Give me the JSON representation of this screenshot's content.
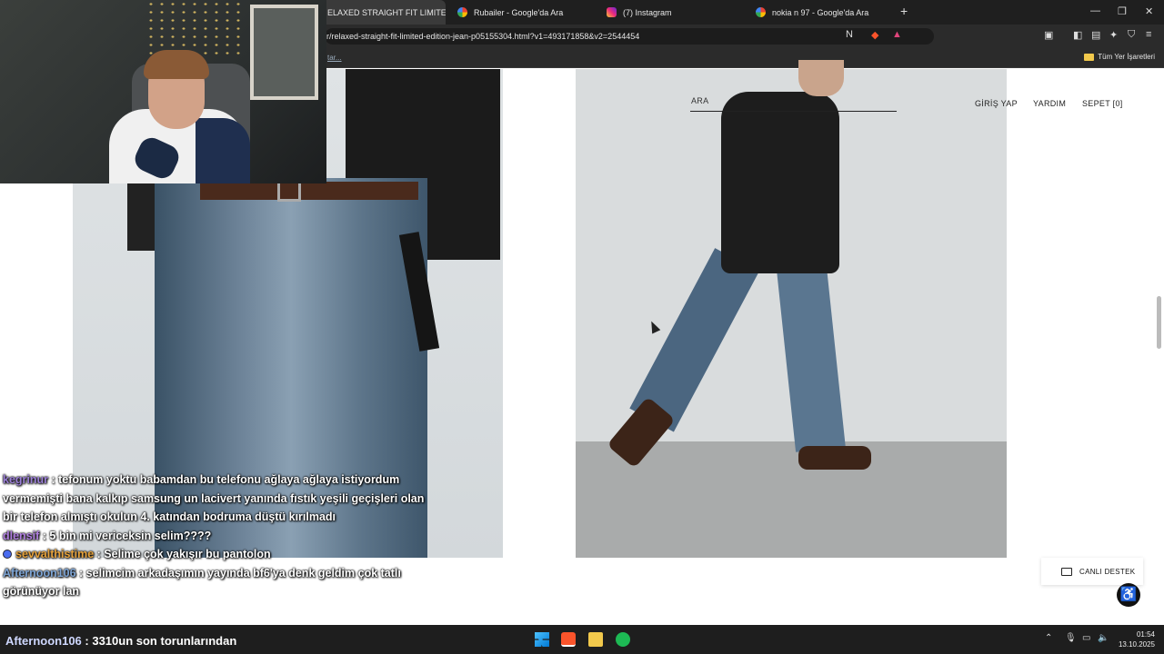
{
  "browser": {
    "tabs": [
      {
        "label": "ELAXED STRAIGHT FIT LIMITED",
        "active": true,
        "favicon": "zara-favicon"
      },
      {
        "label": "Rubailer - Google'da Ara",
        "active": false,
        "favicon": "google-icon"
      },
      {
        "label": "(7) Instagram",
        "active": false,
        "favicon": "instagram-icon"
      },
      {
        "label": "nokia n 97 - Google'da Ara",
        "active": false,
        "favicon": "google-icon"
      }
    ],
    "new_tab": "+",
    "url": "r/relaxed-straight-fit-limited-edition-jean-p05155304.html?v1=493171858&v2=2544454",
    "bookmarks_left": "tar...",
    "bookmarks_right": "Tüm Yer İşaretleri",
    "window_controls": {
      "minimize": "—",
      "restore": "❐",
      "close": "✕"
    }
  },
  "page": {
    "search_label": "ARA",
    "nav": {
      "login": "GİRİŞ YAP",
      "help": "YARDIM",
      "cart": "SEPET [0]"
    },
    "support_label": "CANLI DESTEK",
    "accessibility_icon": "accessibility-icon"
  },
  "chat": {
    "messages": [
      {
        "user": "kegrinur",
        "user_color": "#9b7fd6",
        "text": " : tefonum yoktu babamdan bu telefonu ağlaya ağlaya istiyordum vermemişti bana kalkıp samsung un lacivert yanında fıstık yeşili geçişleri olan bir telefon almıştı okulun 4. katından bodruma düştü kırılmadı"
      },
      {
        "user": "dlensif",
        "user_color": "#b07fe0",
        "text": " : 5 bin mi vericeksin selim????"
      },
      {
        "user": "sevvalthistime",
        "user_color": "#e6a23c",
        "text": " : Selime çok yakışır bu pantolon",
        "badge": true
      },
      {
        "user": "Afternoon106",
        "user_color": "#7fa6d6",
        "text": " : selimcim arkadaşımın yayında bf6'ya denk geldim çok tatlı görünüyor lan"
      }
    ]
  },
  "taskbar": {
    "ticker_user": "Afternoon106",
    "ticker_text": " : 3310un son torunlarından",
    "time": "01:54",
    "date": "13.10.2025"
  },
  "colors": {
    "chrome_dark": "#1f1f1f",
    "accent_access": "#111111"
  }
}
